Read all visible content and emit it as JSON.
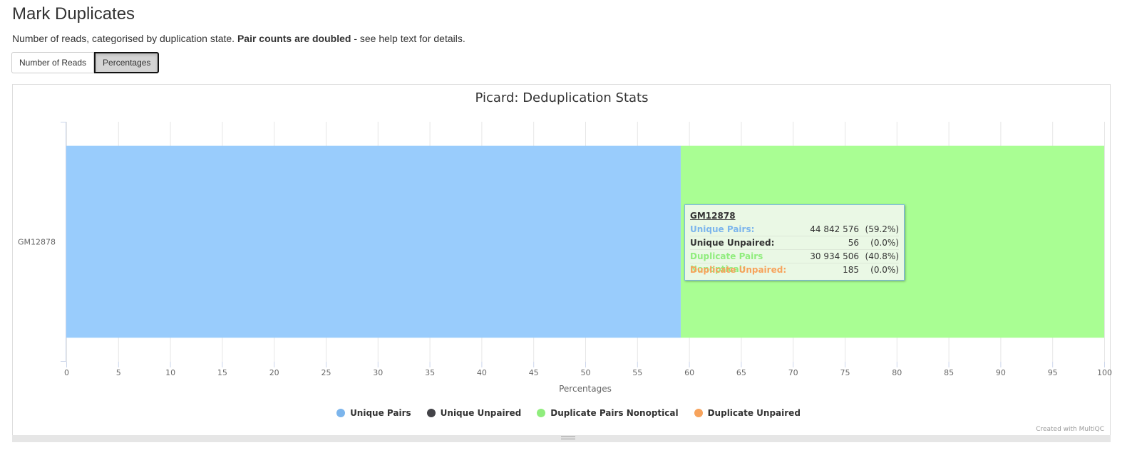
{
  "header": {
    "title": "Mark Duplicates",
    "description_prefix": "Number of reads, categorised by duplication state. ",
    "description_bold": "Pair counts are doubled",
    "description_suffix": " - see help text for details."
  },
  "toggle": {
    "number_of_reads_label": "Number of Reads",
    "percentages_label": "Percentages",
    "active": "Percentages"
  },
  "chart_data": {
    "type": "bar",
    "orientation": "horizontal",
    "stacking": "percent",
    "title": "Picard: Deduplication Stats",
    "xlabel": "Percentages",
    "ylabel": "",
    "categories": [
      "GM12878"
    ],
    "xlim": [
      0,
      100
    ],
    "x_ticks": [
      0,
      5,
      10,
      15,
      20,
      25,
      30,
      35,
      40,
      45,
      50,
      55,
      60,
      65,
      70,
      75,
      80,
      85,
      90,
      95,
      100
    ],
    "grid": true,
    "legend_position": "bottom-center",
    "series": [
      {
        "name": "Unique Pairs",
        "color": "#7cb5ec",
        "bar_color": "#99ccfc",
        "values": [
          59.2
        ],
        "count": "44 842 576",
        "pct": "(59.2%)"
      },
      {
        "name": "Unique Unpaired",
        "color": "#434348",
        "bar_color": "#434348",
        "values": [
          0.0
        ],
        "count": "56",
        "pct": "(0.0%)"
      },
      {
        "name": "Duplicate Pairs Nonoptical",
        "color": "#90ed7d",
        "bar_color": "#a9fe93",
        "values": [
          40.8
        ],
        "count": "30 934 506",
        "pct": "(40.8%)"
      },
      {
        "name": "Duplicate Unpaired",
        "color": "#f7a35c",
        "bar_color": "#f7a35c",
        "values": [
          0.0
        ],
        "count": "185",
        "pct": "(0.0%)"
      }
    ],
    "tooltip": {
      "sample": "GM12878",
      "name_colors": [
        "#7cb5ec",
        "#333333",
        "#90ed7d",
        "#f7a35c"
      ]
    }
  },
  "credit": "Created with MultiQC"
}
